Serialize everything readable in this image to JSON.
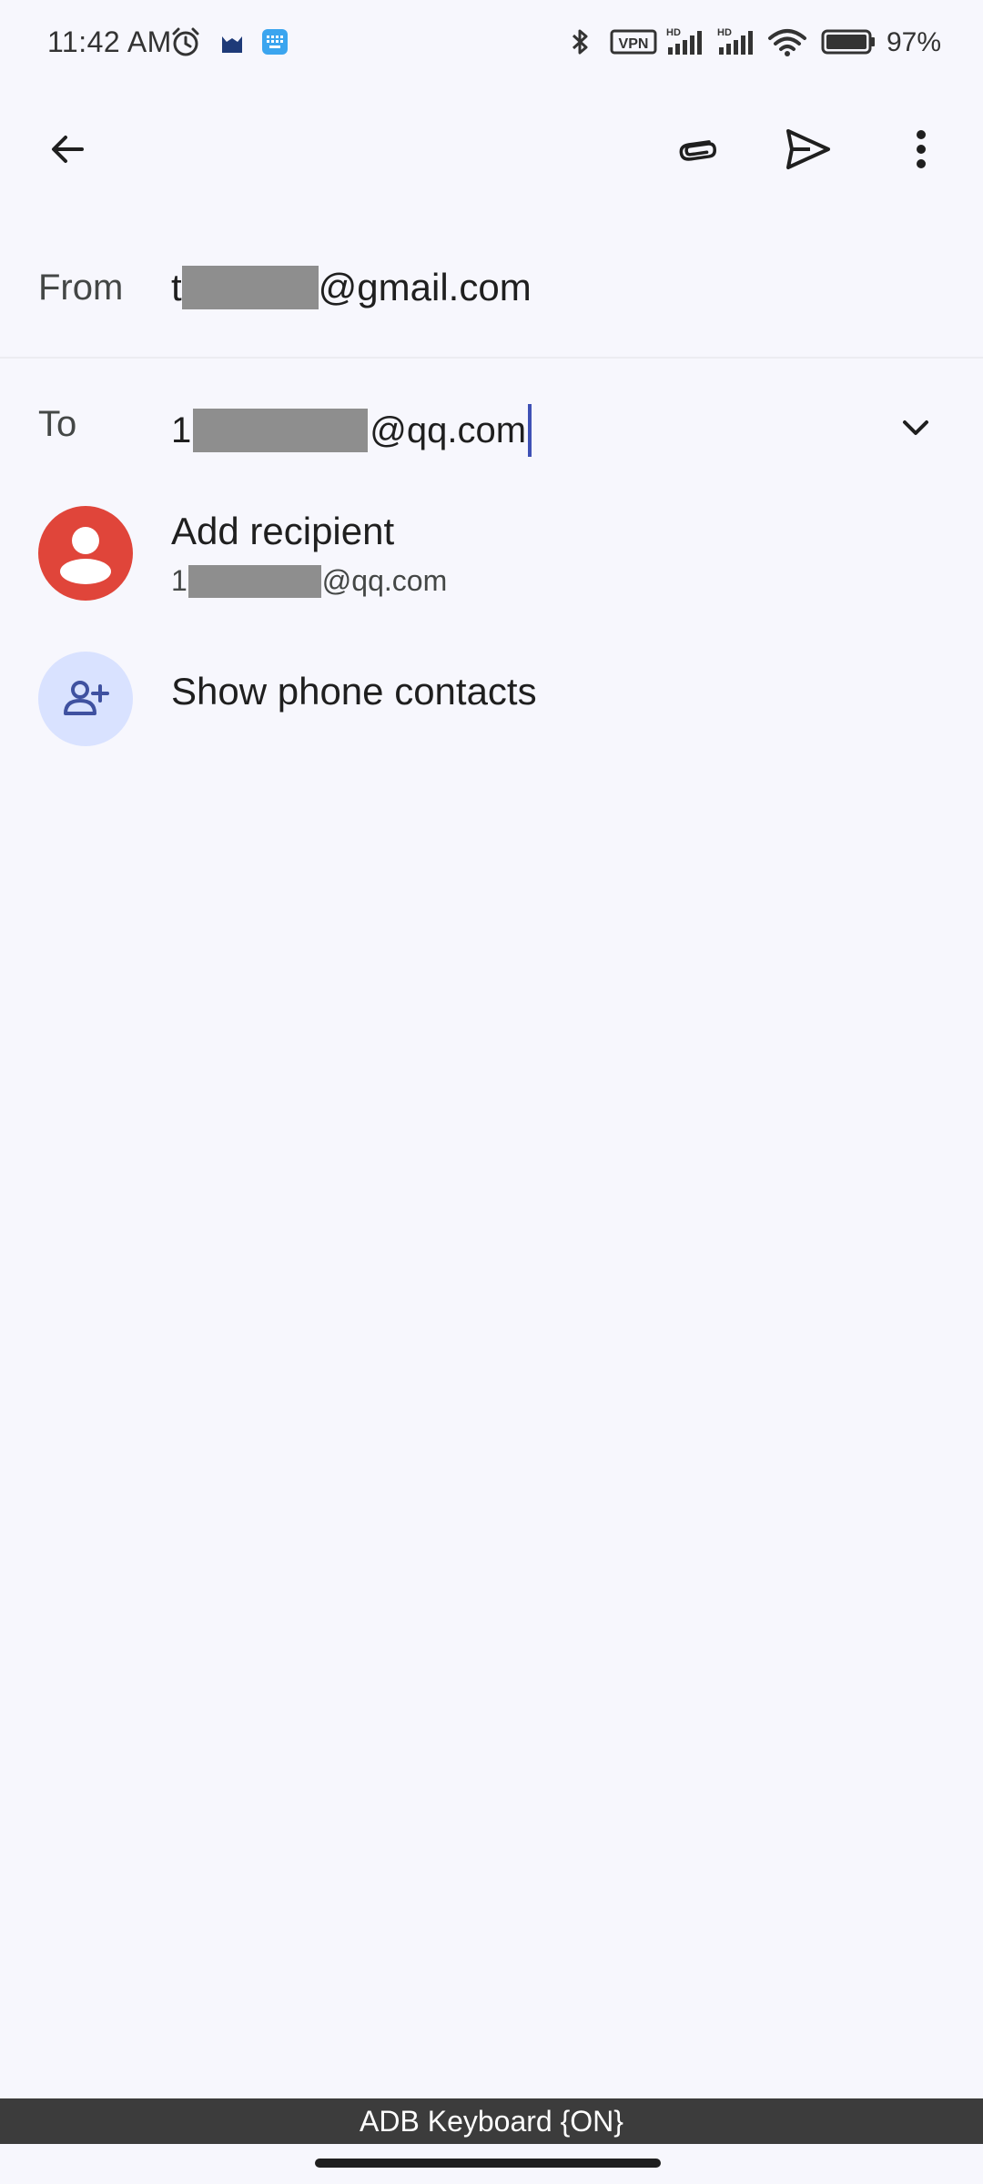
{
  "status_bar": {
    "time": "11:42 AM",
    "battery": "97%",
    "vpn": "VPN",
    "hd": "HD"
  },
  "toolbar": {
    "back_icon": "arrow-back-icon",
    "attach_icon": "paperclip-icon",
    "send_icon": "send-icon",
    "more_icon": "more-vert-icon"
  },
  "compose": {
    "from_label": "From",
    "from_prefix": "t",
    "from_suffix": "@gmail.com",
    "to_label": "To",
    "to_prefix": "1",
    "to_suffix": "@qq.com"
  },
  "suggestions": {
    "add_title": "Add recipient",
    "add_sub_prefix": "1",
    "add_sub_suffix": "@qq.com",
    "contacts_title": "Show phone contacts"
  },
  "footer": {
    "keyboard_status": "ADB Keyboard {ON}"
  },
  "colors": {
    "background": "#f7f7fd",
    "avatar_red": "#e0453a",
    "avatar_blue": "#d9e2ff",
    "accent": "#3f51b5"
  }
}
